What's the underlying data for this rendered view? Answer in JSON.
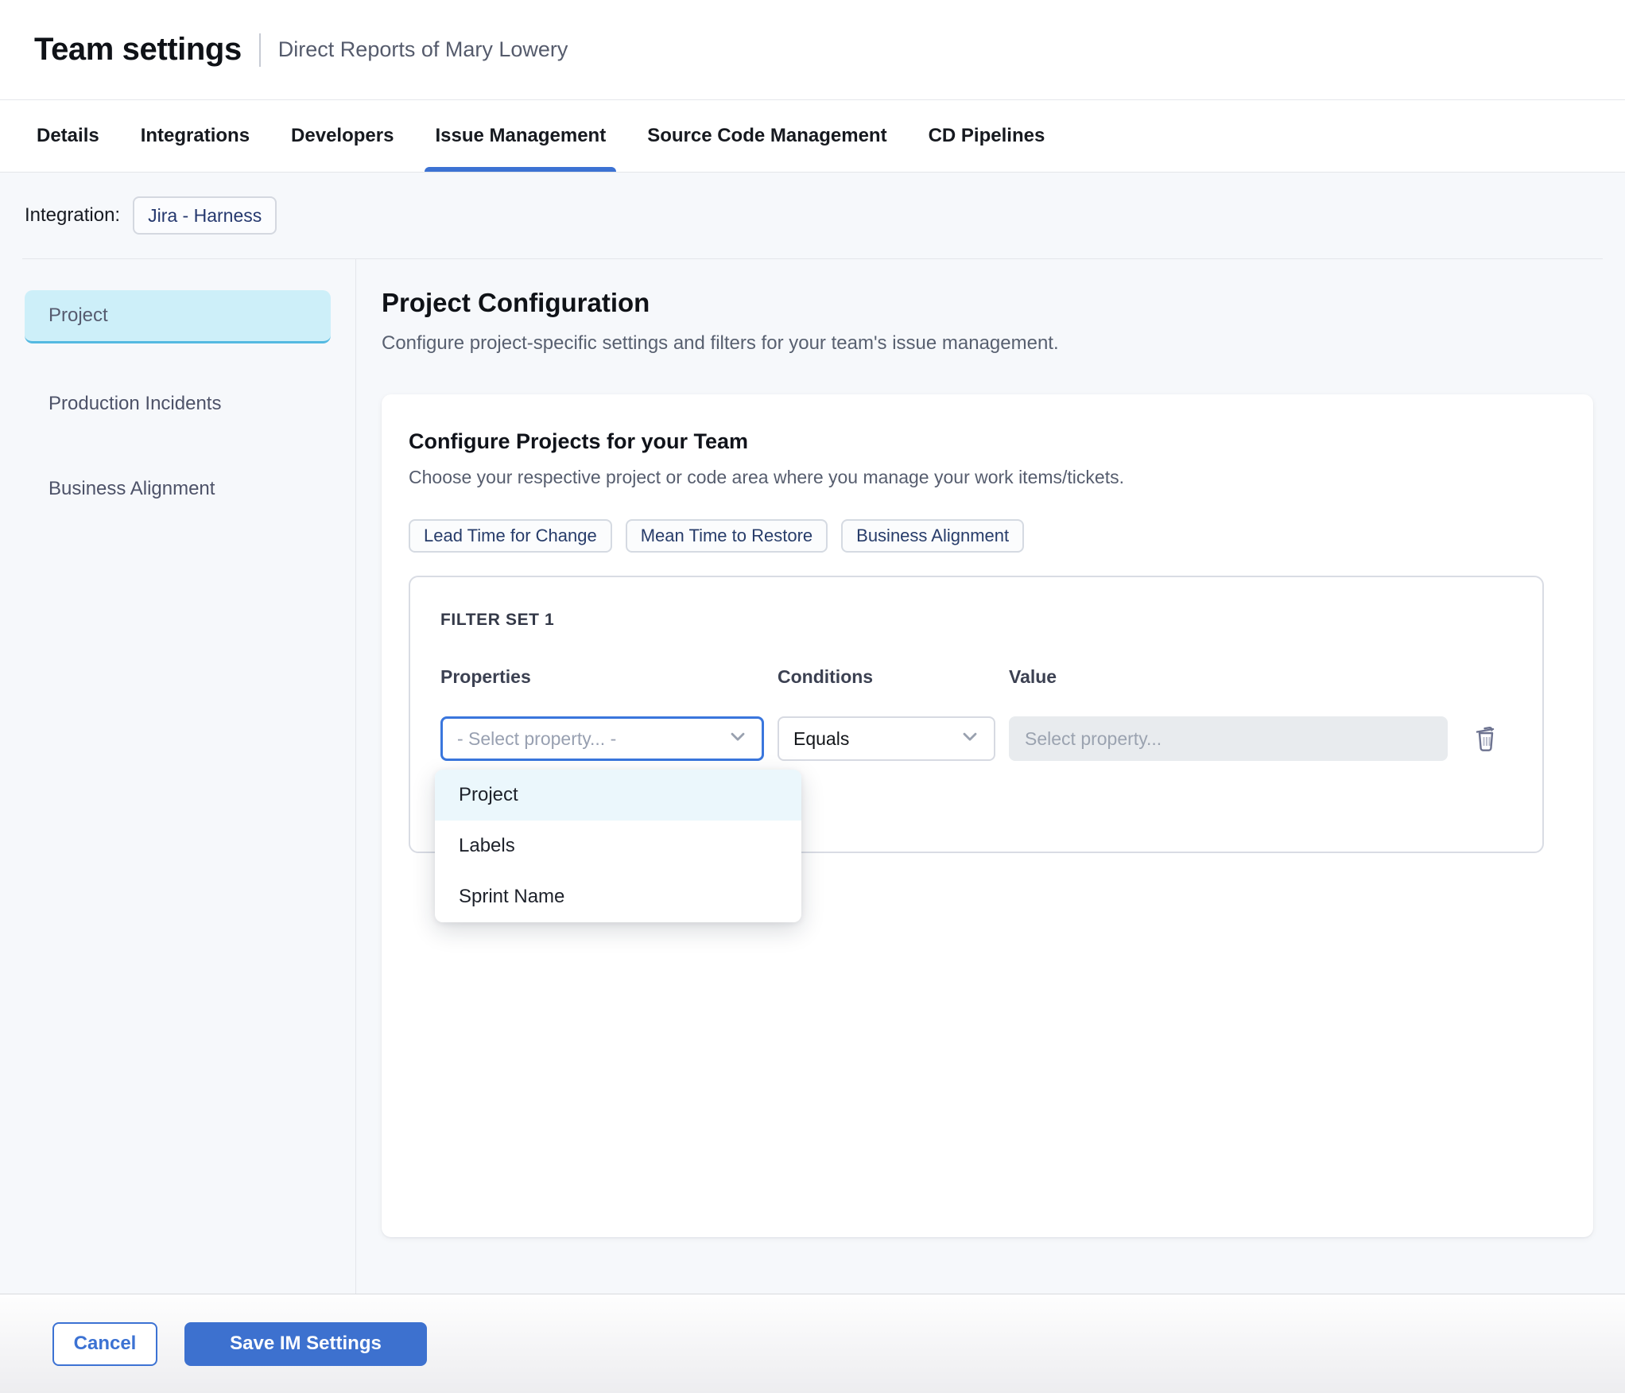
{
  "header": {
    "title": "Team settings",
    "subtitle": "Direct Reports of Mary Lowery"
  },
  "tabs": {
    "items": [
      {
        "label": "Details",
        "active": false
      },
      {
        "label": "Integrations",
        "active": false
      },
      {
        "label": "Developers",
        "active": false
      },
      {
        "label": "Issue Management",
        "active": true
      },
      {
        "label": "Source Code Management",
        "active": false
      },
      {
        "label": "CD Pipelines",
        "active": false
      }
    ]
  },
  "integration": {
    "label": "Integration:",
    "chip": "Jira - Harness"
  },
  "sidebar": {
    "items": [
      {
        "label": "Project",
        "selected": true
      },
      {
        "label": "Production Incidents",
        "selected": false
      },
      {
        "label": "Business Alignment",
        "selected": false
      }
    ]
  },
  "main": {
    "title": "Project Configuration",
    "subtitle": "Configure project-specific settings and filters for your team's issue management.",
    "card": {
      "title": "Configure Projects for your Team",
      "subtitle": "Choose your respective project or code area where you manage your work items/tickets.",
      "metric_chips": [
        {
          "label": "Lead Time for Change"
        },
        {
          "label": "Mean Time to Restore"
        },
        {
          "label": "Business Alignment"
        }
      ],
      "filter_set": {
        "title": "FILTER SET 1",
        "columns": {
          "properties": "Properties",
          "conditions": "Conditions",
          "value": "Value"
        },
        "property_select": {
          "placeholder": "- Select property... -",
          "state": "focused-open"
        },
        "condition_select": {
          "value": "Equals"
        },
        "value_input": {
          "placeholder": "Select property...",
          "state": "disabled"
        },
        "dropdown_options": [
          {
            "label": "Project",
            "highlighted": true
          },
          {
            "label": "Labels",
            "highlighted": false
          },
          {
            "label": "Sprint Name",
            "highlighted": false
          }
        ],
        "icons": {
          "delete": "trash-icon",
          "expand": "chevron-down-icon"
        }
      }
    }
  },
  "footer": {
    "cancel_label": "Cancel",
    "save_label": "Save IM Settings"
  },
  "colors": {
    "accent_blue": "#3c72d3",
    "active_tab_underline": "#3c72d3",
    "selected_sidebar_bg": "#cdeff9",
    "selected_sidebar_border": "#54b9e1",
    "dropdown_highlight_bg": "#ebf7fc",
    "content_bg": "#f6f8fb",
    "focused_select_border": "#3a76dd",
    "chip_text": "#273c6a",
    "disabled_input_bg": "#e8ebee"
  }
}
